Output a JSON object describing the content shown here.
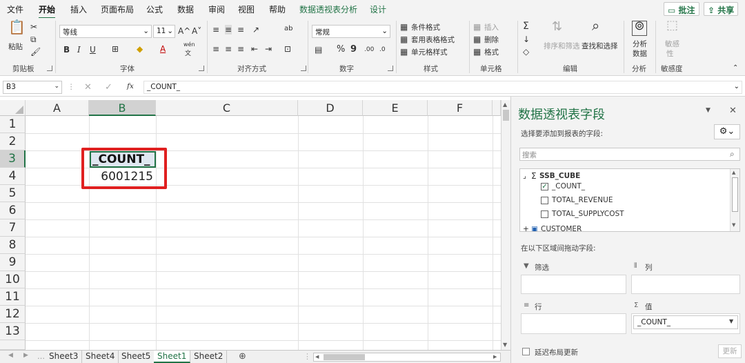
{
  "menu": {
    "tabs": [
      "文件",
      "开始",
      "插入",
      "页面布局",
      "公式",
      "数据",
      "审阅",
      "视图",
      "帮助",
      "数据透视表分析",
      "设计"
    ],
    "annotate_label": "批注",
    "share_label": "共享"
  },
  "ribbon": {
    "clipboard": {
      "paste": "粘贴",
      "group": "剪贴板"
    },
    "font": {
      "name": "等线",
      "size": "11",
      "grow": "A^",
      "shrink": "A˅",
      "bold": "B",
      "italic": "I",
      "underline": "U",
      "color_a": "A",
      "wen": "wén",
      "wen_sub": "文",
      "group": "字体"
    },
    "alignment": {
      "wrap": "ab",
      "group": "对齐方式"
    },
    "number": {
      "format": "常规",
      "percent": "%",
      "comma": "9",
      "group": "数字"
    },
    "styles": {
      "conditional": "条件格式",
      "table": "套用表格格式",
      "cell_styles": "单元格样式",
      "group": "样式"
    },
    "cells": {
      "insert": "插入",
      "delete": "删除",
      "format": "格式",
      "group": "单元格"
    },
    "editing": {
      "sum": "Σ",
      "sort": "排序和筛选",
      "find": "查找和选择",
      "group": "编辑"
    },
    "analysis": {
      "analyze": "分析",
      "analyze2": "数据",
      "group": "分析"
    },
    "sensitivity": {
      "label1": "敏感",
      "label2": "性",
      "group": "敏感度"
    }
  },
  "formula_bar": {
    "name_box": "B3",
    "fx": "fx",
    "content": "_COUNT_"
  },
  "grid": {
    "columns": [
      "A",
      "B",
      "C",
      "D",
      "E",
      "F"
    ],
    "rows": [
      "1",
      "2",
      "3",
      "4",
      "5",
      "6",
      "7",
      "8",
      "9",
      "10",
      "11",
      "12",
      "13"
    ],
    "cells": {
      "B3": "_COUNT_",
      "B4": "6001215"
    },
    "selected_cell": "B3"
  },
  "sheets": {
    "tabs": [
      "Sheet3",
      "Sheet4",
      "Sheet5",
      "Sheet1",
      "Sheet2"
    ],
    "active": "Sheet1",
    "add_symbol": "⊕"
  },
  "pivot_pane": {
    "title": "数据透视表字段",
    "subtitle": "选择要添加到报表的字段:",
    "search_placeholder": "搜索",
    "cube": "SSB_CUBE",
    "fields": [
      {
        "name": "_COUNT_",
        "checked": true
      },
      {
        "name": "TOTAL_REVENUE",
        "checked": false
      },
      {
        "name": "TOTAL_SUPPLYCOST",
        "checked": false
      }
    ],
    "customer": "CUSTOMER",
    "drag_label": "在以下区域间拖动字段:",
    "filter_label": "筛选",
    "columns_label": "列",
    "rows_label": "行",
    "values_label": "值",
    "values_item": "_COUNT_",
    "defer_label": "延迟布局更新",
    "update_label": "更新"
  },
  "colors": {
    "accent": "#217346",
    "highlight_box": "#e02020"
  }
}
